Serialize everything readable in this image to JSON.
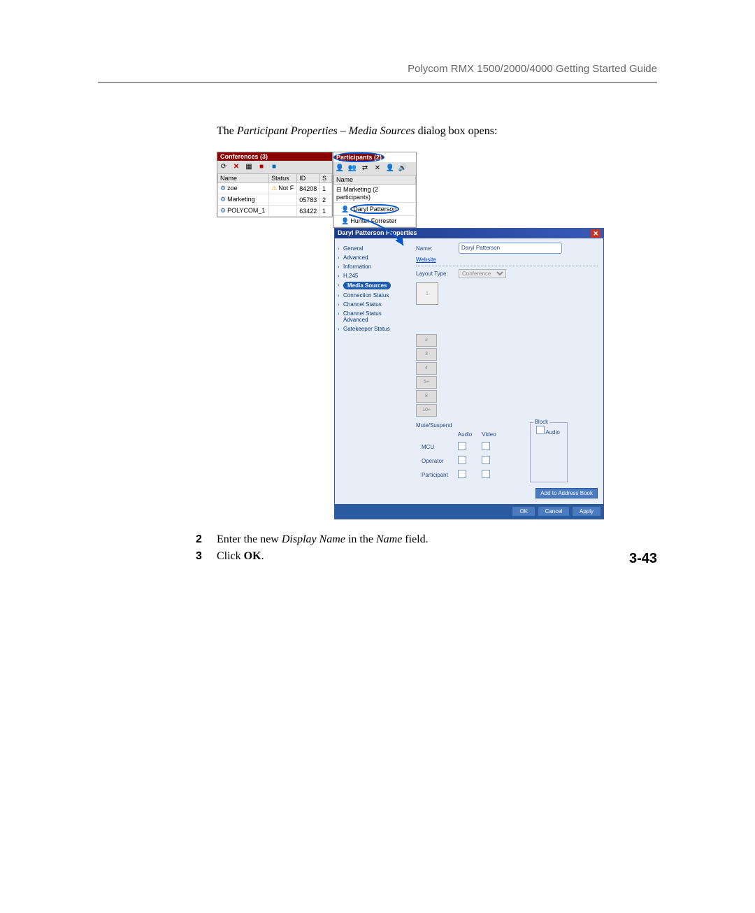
{
  "header": "Polycom RMX 1500/2000/4000 Getting Started Guide",
  "intro_pre": "The ",
  "intro_italic": "Participant Properties – Media Sources",
  "intro_post": " dialog box opens:",
  "conf": {
    "title": "Conferences (3)",
    "cols": {
      "name": "Name",
      "status": "Status",
      "id": "ID",
      "s": "S"
    },
    "rows": [
      {
        "name": "zoe",
        "status": "Not F",
        "id": "84208",
        "s": "1"
      },
      {
        "name": "Marketing",
        "status": "",
        "id": "05783",
        "s": "2"
      },
      {
        "name": "POLYCOM_1",
        "status": "",
        "id": "63422",
        "s": "1"
      }
    ]
  },
  "part": {
    "title": "Participants (2)",
    "col_name": "Name",
    "group": "Marketing (2 participants)",
    "rows": [
      "Daryl Patterson",
      "Hunter Forrester"
    ]
  },
  "dialog": {
    "title": "Daryl Patterson Properties",
    "nav": [
      "General",
      "Advanced",
      "Information",
      "H.245",
      "Media Sources",
      "Connection Status",
      "Channel Status",
      "Channel Status Advanced",
      "Gatekeeper Status"
    ],
    "name_label": "Name:",
    "name_value": "Daryl Patterson",
    "website_label": "Website",
    "layout_label": "Layout Type:",
    "layout_value": "Conference",
    "layout_cells": [
      "1",
      "2",
      "3",
      "4",
      "5+",
      "8",
      "10+"
    ],
    "mute_label": "Mute/Suspend",
    "mute_cols": {
      "audio": "Audio",
      "video": "Video"
    },
    "mute_rows": [
      "MCU",
      "Operator",
      "Participant"
    ],
    "block_legend": "Block",
    "block_audio": "Audio",
    "addr_btn": "Add to Address Book",
    "ok": "OK",
    "cancel": "Cancel",
    "apply": "Apply"
  },
  "steps": [
    {
      "n": "2",
      "pre": "Enter the new ",
      "i1": "Display Name",
      "mid": " in the ",
      "i2": "Name",
      "post": " field."
    },
    {
      "n": "3",
      "pre": "Click ",
      "b": "OK",
      "post": "."
    }
  ],
  "page_number": "3-43"
}
